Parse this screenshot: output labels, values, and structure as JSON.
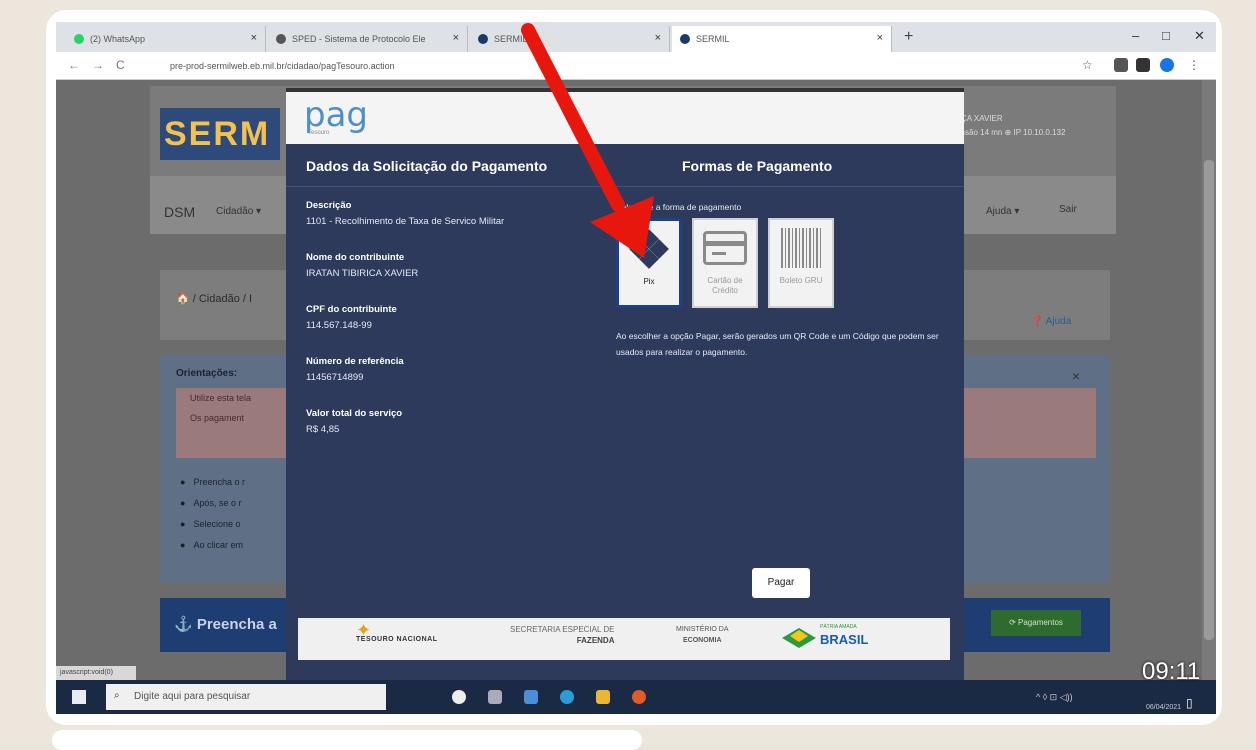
{
  "browser": {
    "tabs": [
      {
        "label": "(2) WhatsApp",
        "color": "#25d366"
      },
      {
        "label": "SPED - Sistema de Protocolo Ele",
        "color": "#555"
      },
      {
        "label": "SERMIL",
        "color": "#1a3a6a"
      },
      {
        "label": "SERMIL",
        "color": "#1a3a6a"
      }
    ],
    "url": "pre-prod-sermilweb.eb.mil.br/cidadao/pagTesouro.action",
    "new_tab": "+",
    "window_controls": [
      "–",
      "□",
      "✕"
    ]
  },
  "background": {
    "logo": "SERM",
    "user_line1": "ÇA XAVIER",
    "user_line2": "ssão 14 mn ⊕ IP 10.10.0.132",
    "menu_dsm": "DSM",
    "menu_cidadao": "Cidadão ▾",
    "menu_ajuda": "Ajuda ▾",
    "menu_sair": "Sair",
    "breadcrumb": "🏠 / Cidadão / I",
    "ajuda_link": "❓ Ajuda",
    "orient_title": "Orientações:",
    "orient_box_lines": [
      "Utilize esta tela",
      "Os pagament"
    ],
    "bullets": [
      "Preencha o r",
      "Após, se o r",
      "Selecione o",
      "Ao clicar em"
    ],
    "fill_title": "⚓ Preencha a",
    "pagamentos_button": "⟳ Pagamentos",
    "status_url": "javascript:void(0)"
  },
  "modal": {
    "logo_text": "pag",
    "logo_sub": "Tesouro",
    "left_title": "Dados da Solicitação do Pagamento",
    "right_title": "Formas de Pagamento",
    "fields": [
      {
        "label": "Descrição",
        "value": "1101 - Recolhimento de Taxa de Servico Militar"
      },
      {
        "label": "Nome do contribuinte",
        "value": "IRATAN TIBIRICA XAVIER"
      },
      {
        "label": "CPF do contribuinte",
        "value": "114.567.148-99"
      },
      {
        "label": "Número de referência",
        "value": "11456714899"
      },
      {
        "label": "Valor total do serviço",
        "value": "R$ 4,85"
      }
    ],
    "select_label": "Selecione a forma de pagamento",
    "methods": [
      {
        "label": "Pix",
        "selected": true,
        "icon": "pix-icon"
      },
      {
        "label": "Cartão de Crédito",
        "selected": false,
        "icon": "credit-card-icon"
      },
      {
        "label": "Boleto GRU",
        "selected": false,
        "icon": "barcode-icon"
      }
    ],
    "note": "Ao escolher a opção Pagar, serão gerados um QR Code e um Código que podem ser usados para realizar o pagamento.",
    "pay_button": "Pagar",
    "footer": {
      "tesouro": "TESOURO NACIONAL",
      "secretaria_line1": "SECRETARIA ESPECIAL DE",
      "secretaria_line2": "FAZENDA",
      "ministerio_line1": "MINISTÉRIO DA",
      "ministerio_line2": "ECONOMIA",
      "brasil_small": "PÁTRIA AMADA",
      "brasil": "BRASIL"
    }
  },
  "taskbar": {
    "search_placeholder": "Digite aqui para pesquisar",
    "tray": "^ ◊ ⊡ ◁))",
    "clock": "09:11",
    "date": "06/04/2021"
  },
  "annotation": {
    "arrow_color": "#e8170e"
  }
}
